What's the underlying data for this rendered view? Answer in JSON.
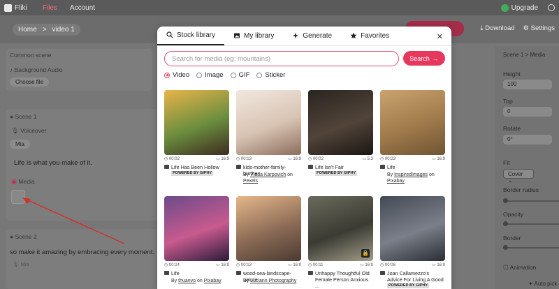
{
  "app": {
    "name": "Fliki",
    "nav": [
      "Files",
      "Account"
    ],
    "upgrade": "Upgrade"
  },
  "toolbar": {
    "breadcrumb": [
      "Home",
      ">",
      "video 1"
    ],
    "download": "Download",
    "settings": "Settings"
  },
  "left": {
    "common_scene": "Common scene",
    "background_audio": "Background Audio",
    "choose_file": "Choose file",
    "scene1": "Scene 1",
    "voiceover": "Voiceover",
    "voice": "Mia",
    "scene1_text": "Life is what you make of it.",
    "media": "Media",
    "scene2": "Scene 2",
    "scene2_text": "so make it amazing by embracing every moment.",
    "voice2": "Mia"
  },
  "right": {
    "crumb": [
      "Scene 1",
      ">",
      "Media"
    ],
    "height_label": "Height",
    "height_value": "100",
    "top_label": "Top",
    "top_value": "0",
    "rotate_label": "Rotate",
    "rotate_value": "0°",
    "fit_label": "Fit",
    "fit_value": "Cover",
    "border_radius": "Border radius",
    "opacity": "Opacity",
    "border": "Border",
    "animation": "Animation",
    "auto_pick": "Auto pick"
  },
  "modal": {
    "tabs": [
      "Stock library",
      "My library",
      "Generate",
      "Favorites"
    ],
    "search_placeholder": "Search for media (eg: mountains)",
    "search_button": "Search",
    "types": [
      "Video",
      "Image",
      "GIF",
      "Sticker"
    ],
    "selected_type": "Video",
    "items": [
      {
        "duration": "00:02",
        "ratio": "16:9",
        "title": "Life Has Been Hollow",
        "by_prefix": "",
        "author": "",
        "source": "",
        "giphy": true,
        "colors": [
          "#e9b44a",
          "#6b8e3e",
          "#3d2b1f"
        ]
      },
      {
        "duration": "00:13",
        "ratio": "16:9",
        "title": "kids-mother-family-brother",
        "by_prefix": "By",
        "author": "Vlada Karpovich",
        "on": "on",
        "source": "Pexels",
        "giphy": false,
        "colors": [
          "#f2e8df",
          "#d8c4b4",
          "#8c6e5c"
        ]
      },
      {
        "duration": "00:02",
        "ratio": "5:3",
        "title": "Life Isn't Fair",
        "by_prefix": "",
        "author": "",
        "source": "",
        "giphy": true,
        "colors": [
          "#2a2520",
          "#51443a",
          "#1b1612"
        ]
      },
      {
        "duration": "00:23",
        "ratio": "16:9",
        "title": "Life",
        "by_prefix": "By",
        "author": "InspiredImages",
        "on": "on",
        "source": "Pixabay",
        "giphy": false,
        "colors": [
          "#c9a36f",
          "#a07a4a",
          "#6e5434"
        ]
      },
      {
        "duration": "00:24",
        "ratio": "16:9",
        "title": "Life",
        "by_prefix": "By",
        "author": "thuanvo",
        "on": "on",
        "source": "Pixabay",
        "giphy": false,
        "colors": [
          "#6b4b8a",
          "#c85a8e",
          "#2a1b3a"
        ]
      },
      {
        "duration": "00:13",
        "ratio": "16:9",
        "title": "wood-sea-landscape-nature",
        "by_prefix": "By",
        "author": "Luciann Photography",
        "on": "",
        "source": "",
        "giphy": false,
        "colors": [
          "#e6b78a",
          "#8a6a55",
          "#4a3a30"
        ]
      },
      {
        "duration": "00:11",
        "ratio": "16:9",
        "title": "Unhappy Thoughtful Old Female Person Anxious ...",
        "by_prefix": "",
        "author": "",
        "source": "",
        "giphy": false,
        "locked": true,
        "colors": [
          "#6a6a5c",
          "#3b3b33",
          "#a29d88"
        ]
      },
      {
        "duration": "00:06",
        "ratio": "16:9",
        "title": "Joan Callamezzo's Advice For Living A Good Li...",
        "by_prefix": "",
        "author": "",
        "source": "",
        "giphy": true,
        "colors": [
          "#444a55",
          "#7a7f89",
          "#2a2d33"
        ]
      }
    ],
    "giphy_label": "POWERED BY GIPHY"
  },
  "colors": {
    "accent": "#e8375d",
    "upgrade": "#3fae5a"
  }
}
